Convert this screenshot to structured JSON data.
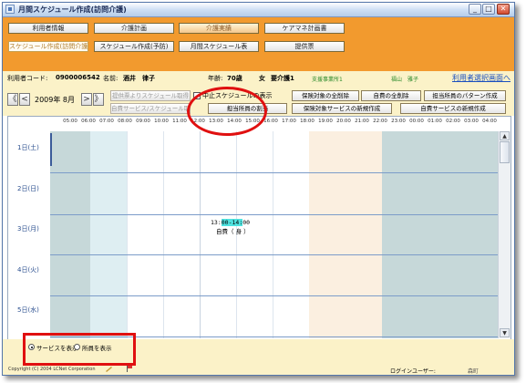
{
  "window": {
    "title": "月間スケジュール作成(訪問介護)"
  },
  "nav": {
    "row1": [
      "利用者情報",
      "介護計画",
      "介護実績",
      "ケアマネ計画書"
    ],
    "row2": [
      "スケジュール作成(訪問介護)",
      "スケジュール作成(予防)",
      "月間スケジュール表",
      "提供票"
    ]
  },
  "info": {
    "user_code_label": "利用者コード:",
    "user_code": "0900006542",
    "name_label": "名前:",
    "name": "酒井　律子",
    "age_label": "年齢:",
    "age": "70歳",
    "gender": "女",
    "care_level": "要介護1",
    "office": "支援事業所1",
    "manager": "福山　雅子",
    "select_link": "利用者選択画面へ"
  },
  "period": {
    "prev_year": "《",
    "prev_month": "<",
    "year_month": "2009年 8月",
    "next_month": ">",
    "next_year": "》"
  },
  "buttons": {
    "get_from_teikyo": "提供票よりスケジュール取得",
    "get_self_service": "自費サービス/スケジュール取得",
    "show_cancelled": "中止スケジュールの表示",
    "delete_insured": "保険対象の全削除",
    "delete_self": "自費の全削除",
    "staff_pattern": "担当所員のパターン作成",
    "assign_staff": "担当所員の割当",
    "new_insured_service": "保険対象サービスの新規作成",
    "new_self_service": "自費サービスの新規作成"
  },
  "timeline": {
    "hours": [
      "05:00",
      "06:00",
      "07:00",
      "08:00",
      "09:00",
      "10:00",
      "11:00",
      "12:00",
      "13:00",
      "14:00",
      "15:00",
      "16:00",
      "17:00",
      "18:00",
      "19:00",
      "20:00",
      "21:00",
      "22:00",
      "23:00",
      "00:00",
      "01:00",
      "02:00",
      "03:00",
      "04:00"
    ],
    "days": [
      "1日(土)",
      "2日(日)",
      "3日(月)",
      "4日(火)",
      "5日(水)"
    ],
    "event": {
      "time_start": "13:",
      "time_highlight": "00-14:",
      "time_end": "00",
      "label": "自費（ 身 ）"
    }
  },
  "colors": {
    "header_orange": "#f29a2e",
    "info_yellow": "#fbf2c8",
    "night_band": "#c6d8d9",
    "morning_band": "#deeef2",
    "evening_band": "#fbefe0",
    "event_highlight": "#4fe3e0",
    "annotation_red": "#e01010"
  },
  "footer": {
    "radio_service": "サービスを表示",
    "radio_staff": "所員を表示",
    "copyright": "Copyright (C) 2004 LCNet Corporation",
    "login_label": "ログインユーザー:",
    "login_user": "森町"
  }
}
